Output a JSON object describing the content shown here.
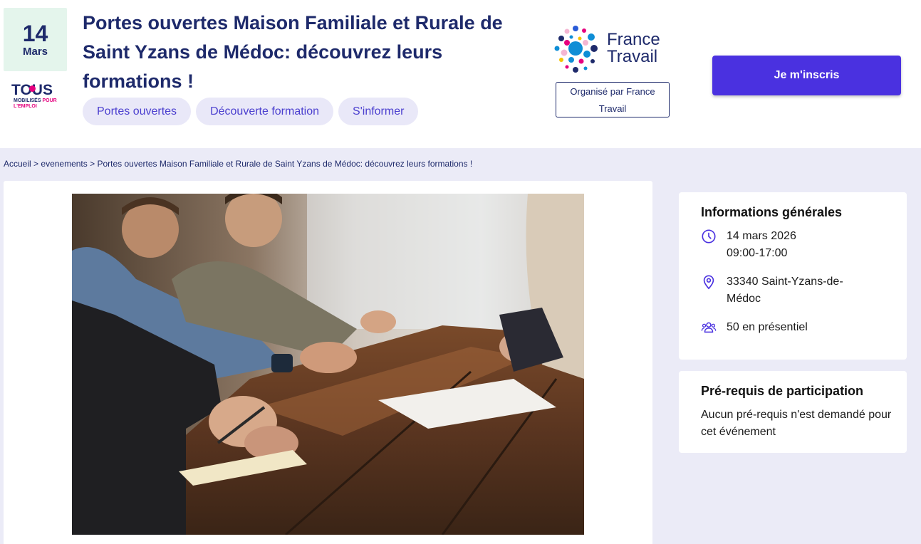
{
  "event": {
    "day": "14",
    "month": "Mars",
    "title": "Portes ouvertes Maison Familiale et Rurale de Saint Yzans de Médoc: découvrez leurs formations !",
    "tags": [
      "Portes ouvertes",
      "Découverte formation",
      "S'informer"
    ]
  },
  "logos": {
    "tous_word": "TOUS",
    "tous_sub_1": "MOBILISÉS",
    "tous_sub_2": "POUR",
    "tous_sub_3": "L'EMPLOI",
    "france_travail_line1": "France",
    "france_travail_line2": "Travail"
  },
  "organizer": {
    "label": "Organisé par France Travail"
  },
  "cta": {
    "register_label": "Je m'inscris"
  },
  "breadcrumb": {
    "home": "Accueil",
    "section": "evenements",
    "current": "Portes ouvertes Maison Familiale et Rurale de Saint Yzans de Médoc: découvrez leurs formations !",
    "separator": ">"
  },
  "info": {
    "title": "Informations générales",
    "date": "14 mars 2026",
    "time": "09:00-17:00",
    "location_line1": "33340 Saint-Yzans-de-",
    "location_line2": "Médoc",
    "attendance": "50 en présentiel"
  },
  "prereq": {
    "title": "Pré-requis de participation",
    "text": "Aucun pré-requis n'est demandé pour cet événement"
  },
  "colors": {
    "navy": "#1e2a6b",
    "accent": "#4a31e0",
    "tag_bg": "#e9e8f8",
    "date_bg": "#e4f5ec",
    "page_bg": "#ebebf7"
  },
  "icons": {
    "time": "clock-icon",
    "location": "map-pin-icon",
    "attendance": "people-icon"
  }
}
